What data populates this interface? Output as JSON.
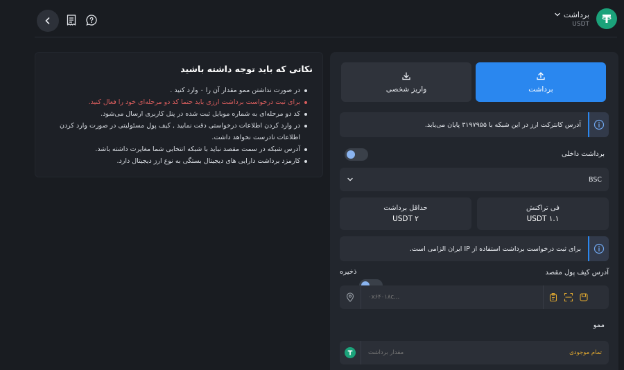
{
  "header": {
    "title": "برداشت",
    "subtitle": "USDT",
    "icons": [
      "chevron-left-icon",
      "receipt-icon",
      "help-chat-icon",
      "chevron-down-icon",
      "tether-logo"
    ]
  },
  "notes": {
    "title": "نکاتی که باید توجه داشته باشید",
    "items": [
      {
        "text": "در صورت نداشتن ممو مقدار آن را ۰ وارد کنید .",
        "warn": false
      },
      {
        "text": "برای ثبت درخواست برداشت ارزی باید حتما کد دو مرحله‌ای خود را فعال کنید.",
        "warn": true
      },
      {
        "text": "کد دو مرحله‌ای به شماره موبایل ثبت شده در پنل کاربری ارسال می‌شود.",
        "warn": false
      },
      {
        "text": "در وارد کردن اطلاعات درخواستی دقت نمایید , کیف پول مسئولیتی در صورت وارد کردن اطلاعات نادرست نخواهد داشت.",
        "warn": false
      },
      {
        "text": "آدرس شبکه در سمت مقصد نباید با شبکه انتخابی شما مغایرت داشته باشد.",
        "warn": false
      },
      {
        "text": "کارمزد برداشت دارایی های دیجیتال بستگی به نوع ارز دیجیتال دارد.",
        "warn": false
      }
    ]
  },
  "form": {
    "tabs": {
      "withdraw": "برداشت",
      "personal_deposit": "واریز شخصی"
    },
    "contract_info": "آدرس کانترکت ارز در این شبکه با ۳۱۹۷۹۵۵ پایان می‌یابد.",
    "internal_withdraw_label": "برداشت داخلی",
    "network_value": "BSC",
    "fee_label": "فی تراکنش",
    "fee_value": "۱.۱ USDT",
    "min_label": "حداقل برداشت",
    "min_value": "۲ USDT",
    "ip_info": "برای ثبت درخواست برداشت استفاده از IP ایران الزامی است.",
    "address_label": "آدرس کیف پول مقصد",
    "save_label": "ذخیره",
    "address_placeholder": "۰x۶۴۰۱۸c...",
    "memo_label": "ممو",
    "amount_placeholder": "مقدار برداشت",
    "all_balance": "تمام موجودی"
  },
  "colors": {
    "accent": "#2a87ef",
    "warning": "#d95d5d",
    "max_link": "#e0a830",
    "tether": "#1ba27a"
  }
}
